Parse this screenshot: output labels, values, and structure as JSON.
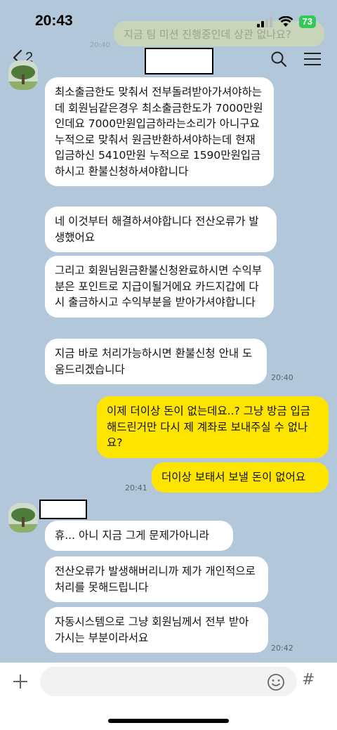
{
  "status": {
    "time": "20:43",
    "battery": "73"
  },
  "background_ghost": {
    "text": "지금 팀 미션 진행중인데 상관 없나요?",
    "time": "20:40"
  },
  "header": {
    "unread_count": "2"
  },
  "messages": [
    {
      "text": "최소출금한도 맞춰서 전부돌려받아가셔야하는데 회원님같은경우 최소출금한도가 7000만원인데요 7000만원입금하라는소리가 아니구요 누적으로 맞춰서 원금반환하셔야하는데 현재 입금하신 5410만원 누적으로 1590만원입금하시고 환불신청하셔야합니다"
    },
    {
      "text": "네 이것부터 해결하셔야합니다 전산오류가 발생했어요"
    },
    {
      "text": "그리고 회원님원금환불신청완료하시면 수익부분은 포인트로 지급이될거에요 카드지갑에 다시 출금하시고 수익부분을 받아가셔야합니다"
    },
    {
      "text": "지금 바로 처리가능하시면 환불신청 안내 도움드리겠습니다",
      "time": "20:40"
    },
    {
      "text": "이제 더이상 돈이 없는데요..? 그냥 방금 입금해드린거만 다시 제 계좌로 보내주실 수 없나요?"
    },
    {
      "text": "더이상 보태서 보낼 돈이 없어요",
      "time": "20:41"
    },
    {
      "text": "휴... 아니 지금 그게 문제가아니라"
    },
    {
      "text": "전산오류가 발생해버리니까 제가 개인적으로 처리를 못해드립니다"
    },
    {
      "text": "자동시스템으로 그냥 회원님께서 전부 받아가시는 부분이라서요",
      "time": "20:42"
    }
  ],
  "icons": {
    "back": "chevron-left-icon",
    "search": "search-icon",
    "menu": "menu-icon",
    "plus": "plus-icon",
    "emoji": "emoji-icon",
    "hash": "hash-icon",
    "signal": "signal-icon",
    "wifi": "wifi-icon"
  },
  "input": {
    "hash_label": "#"
  },
  "colors": {
    "background": "#b2c7da",
    "my_bubble": "#fee500",
    "their_bubble": "#ffffff",
    "battery": "#34c759"
  }
}
